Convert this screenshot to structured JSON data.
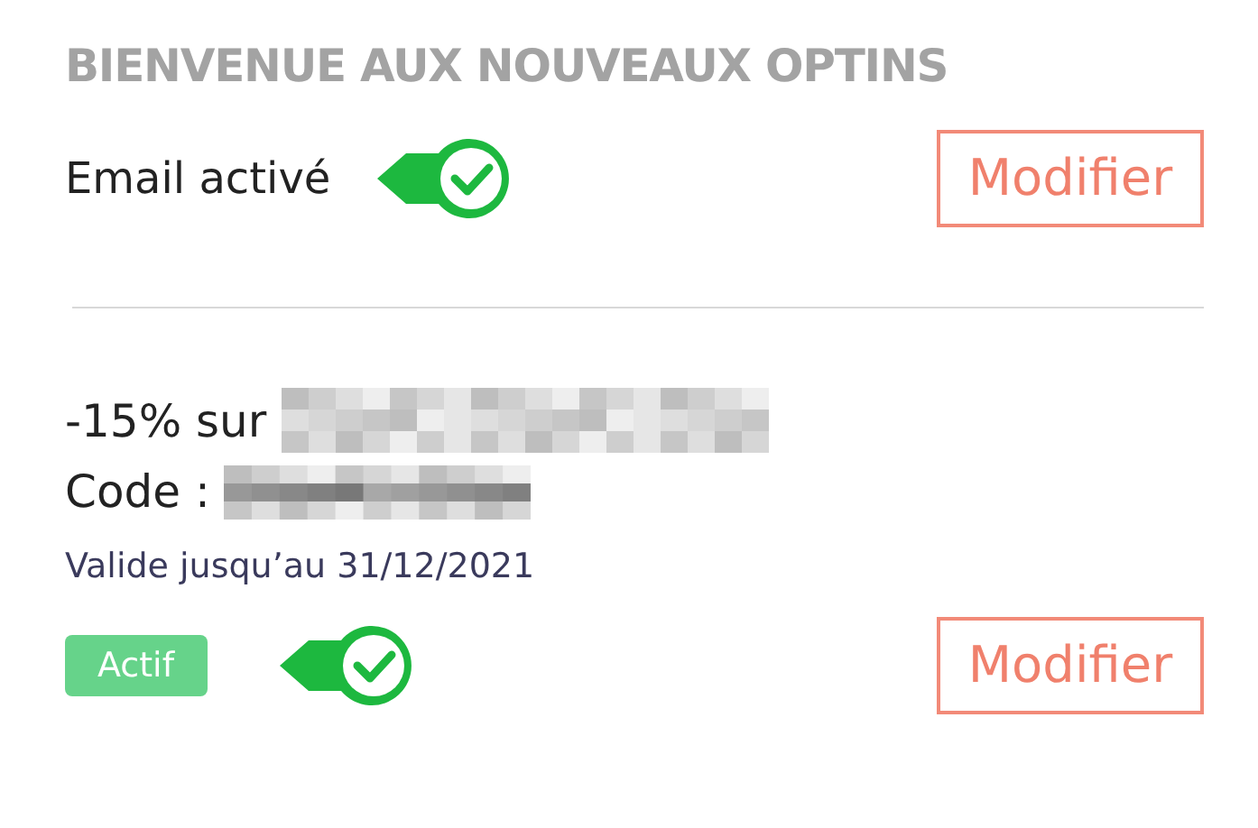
{
  "title": "BIENVENUE AUX NOUVEAUX OPTINS",
  "email": {
    "label": "Email activé",
    "on": true,
    "button": "Modifier"
  },
  "offer": {
    "discount_label": "-15% sur",
    "code_label": "Code :",
    "validity": "Valide jusqu’au 31/12/2021",
    "status": "Actif",
    "on": true,
    "button": "Modifier"
  }
}
